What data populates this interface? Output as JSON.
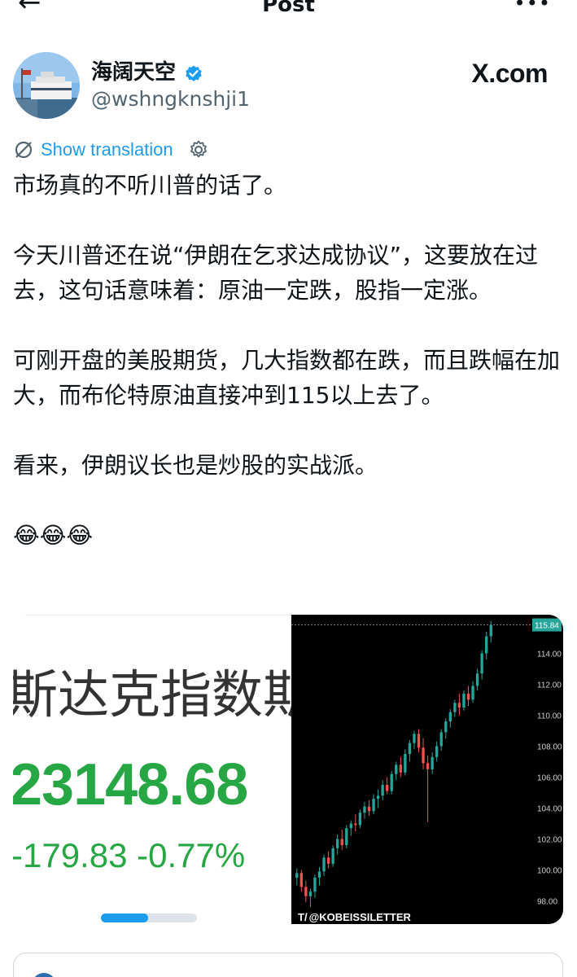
{
  "header": {
    "title": "Post"
  },
  "author": {
    "display_name": "海阔天空",
    "handle": "@wshngknshji1",
    "source": "X.com"
  },
  "translation": {
    "label": "Show translation"
  },
  "post": {
    "paragraphs": [
      "市场真的不听川普的话了。",
      "今天川普还在说“伊朗在乞求达成协议”，这要放在过去，这句话意味着：原油一定跌，股指一定涨。",
      "可刚开盘的美股期货，几大指数都在跌，而且跌幅在加大，而布伦特原油直接冲到115以上去了。",
      "看来，伊朗议长也是炒股的实战派。",
      "😂😂😂"
    ]
  },
  "media": {
    "left": {
      "title": "斯达克指数期",
      "price": "23148.68",
      "change": "-179.83   -0.77%"
    },
    "right": {
      "watermark": "@KOBEISSILETTER",
      "chart_data": {
        "type": "candlestick",
        "y_ticks": [
          "114.00",
          "112.00",
          "110.00",
          "108.00",
          "106.00",
          "104.00",
          "102.00",
          "100.00",
          "98.00"
        ],
        "last_price_label": "115.84",
        "ylim": [
          96.5,
          116.5
        ],
        "candles": [
          [
            99.5,
            100.1,
            99.0,
            99.8
          ],
          [
            99.8,
            100.0,
            98.6,
            98.9
          ],
          [
            98.9,
            99.3,
            97.9,
            98.3
          ],
          [
            98.3,
            98.8,
            97.6,
            98.6
          ],
          [
            98.6,
            99.7,
            98.2,
            99.5
          ],
          [
            99.5,
            100.2,
            99.0,
            99.9
          ],
          [
            99.9,
            101.0,
            99.6,
            100.8
          ],
          [
            100.8,
            101.2,
            100.1,
            100.4
          ],
          [
            100.4,
            101.6,
            100.2,
            101.4
          ],
          [
            101.4,
            102.3,
            101.0,
            102.0
          ],
          [
            102.0,
            102.6,
            101.3,
            101.6
          ],
          [
            101.6,
            102.9,
            101.4,
            102.7
          ],
          [
            102.7,
            103.2,
            102.2,
            103.0
          ],
          [
            103.0,
            103.6,
            102.5,
            102.9
          ],
          [
            102.9,
            103.9,
            102.7,
            103.7
          ],
          [
            103.7,
            104.4,
            103.3,
            104.1
          ],
          [
            104.1,
            104.5,
            103.5,
            103.8
          ],
          [
            103.8,
            104.9,
            103.6,
            104.6
          ],
          [
            104.6,
            105.2,
            104.0,
            104.8
          ],
          [
            104.8,
            105.8,
            104.5,
            105.5
          ],
          [
            105.5,
            106.0,
            104.9,
            105.1
          ],
          [
            105.1,
            106.4,
            104.9,
            106.2
          ],
          [
            106.2,
            107.0,
            105.8,
            106.8
          ],
          [
            106.8,
            107.3,
            106.0,
            106.3
          ],
          [
            106.3,
            107.8,
            106.1,
            107.5
          ],
          [
            107.5,
            108.4,
            107.0,
            108.2
          ],
          [
            108.2,
            109.0,
            107.8,
            108.8
          ],
          [
            108.8,
            109.1,
            107.6,
            107.9
          ],
          [
            107.9,
            108.5,
            106.5,
            106.9
          ],
          [
            106.9,
            107.4,
            103.1,
            106.5
          ],
          [
            106.5,
            107.6,
            106.2,
            107.3
          ],
          [
            107.3,
            108.3,
            107.0,
            108.0
          ],
          [
            108.0,
            109.1,
            107.7,
            108.9
          ],
          [
            108.9,
            109.8,
            108.5,
            109.6
          ],
          [
            109.6,
            110.4,
            109.2,
            110.2
          ],
          [
            110.2,
            111.0,
            109.9,
            110.8
          ],
          [
            110.8,
            111.4,
            110.0,
            110.5
          ],
          [
            110.5,
            111.6,
            110.3,
            111.4
          ],
          [
            111.4,
            111.9,
            110.6,
            111.0
          ],
          [
            111.0,
            112.2,
            110.8,
            111.9
          ],
          [
            111.9,
            113.0,
            111.6,
            112.7
          ],
          [
            112.7,
            114.2,
            112.3,
            114.0
          ],
          [
            114.0,
            115.4,
            113.6,
            115.1
          ],
          [
            115.1,
            116.1,
            114.7,
            115.84
          ]
        ]
      }
    }
  }
}
